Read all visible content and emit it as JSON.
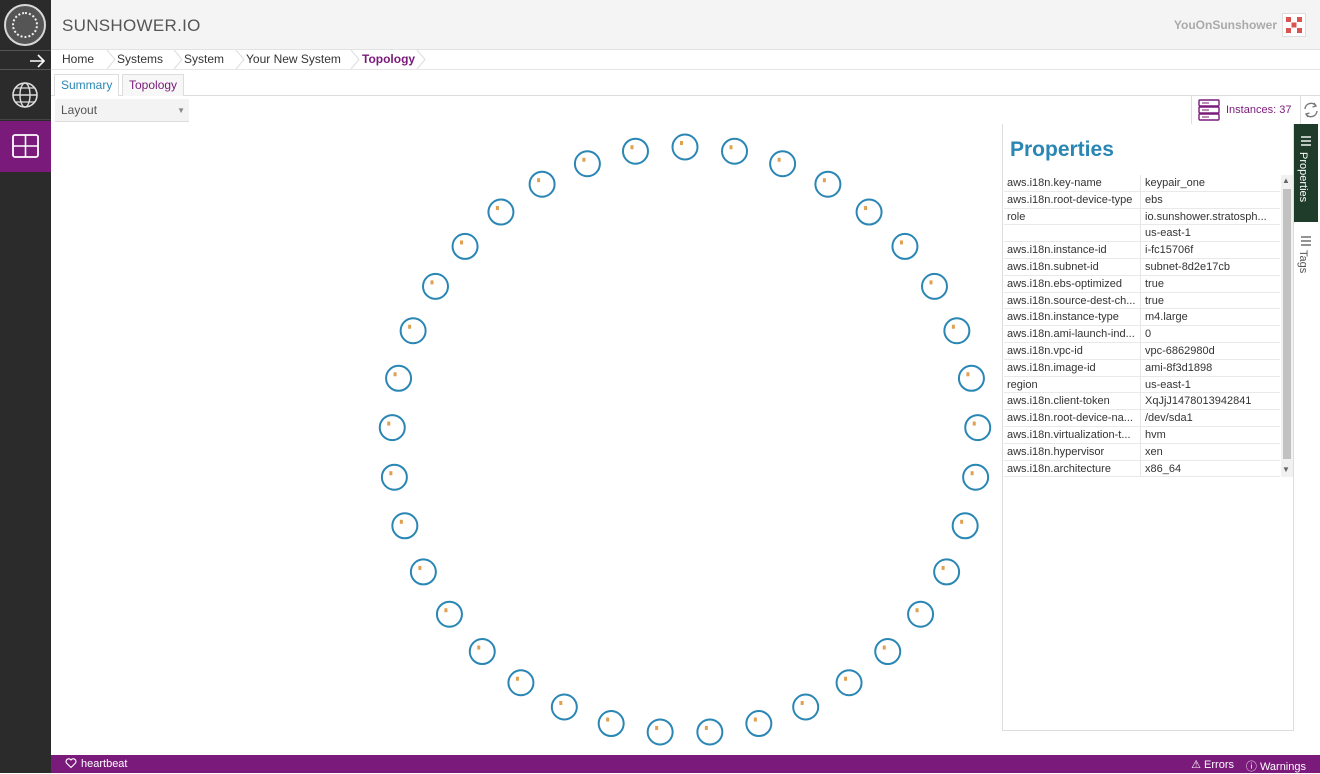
{
  "app": {
    "brand": "SUNSHOWER.IO",
    "user": "YouOnSunshower"
  },
  "breadcrumb": [
    "Home",
    "Systems",
    "System",
    "Your New System",
    "Topology"
  ],
  "tabs": {
    "summary": "Summary",
    "topology": "Topology"
  },
  "toolbar": {
    "layout_label": "Layout",
    "instances_label": "Instances: 37"
  },
  "topology": {
    "node_count": 37,
    "layout": "circle",
    "node_color": "#2a86b4"
  },
  "properties": {
    "title": "Properties",
    "rows": [
      {
        "key": "aws.i18n.key-name",
        "value": "keypair_one"
      },
      {
        "key": "aws.i18n.root-device-type",
        "value": "ebs"
      },
      {
        "key": "role",
        "value": "io.sunshower.stratosph..."
      },
      {
        "key": "",
        "value": "us-east-1"
      },
      {
        "key": "aws.i18n.instance-id",
        "value": "i-fc15706f"
      },
      {
        "key": "aws.i18n.subnet-id",
        "value": "subnet-8d2e17cb"
      },
      {
        "key": "aws.i18n.ebs-optimized",
        "value": "true"
      },
      {
        "key": "aws.i18n.source-dest-ch...",
        "value": "true"
      },
      {
        "key": "aws.i18n.instance-type",
        "value": "m4.large"
      },
      {
        "key": "aws.i18n.ami-launch-ind...",
        "value": "0"
      },
      {
        "key": "aws.i18n.vpc-id",
        "value": "vpc-6862980d"
      },
      {
        "key": "aws.i18n.image-id",
        "value": "ami-8f3d1898"
      },
      {
        "key": "region",
        "value": "us-east-1"
      },
      {
        "key": "aws.i18n.client-token",
        "value": "XqJjJ1478013942841"
      },
      {
        "key": "aws.i18n.root-device-na...",
        "value": "/dev/sda1"
      },
      {
        "key": "aws.i18n.virtualization-t...",
        "value": "hvm"
      },
      {
        "key": "aws.i18n.hypervisor",
        "value": "xen"
      },
      {
        "key": "aws.i18n.architecture",
        "value": "x86_64"
      }
    ]
  },
  "side_tabs": {
    "properties": "Properties",
    "tags": "Tags"
  },
  "footer": {
    "heartbeat": "heartbeat",
    "errors": "Errors",
    "warnings": "Warnings"
  },
  "colors": {
    "brand_purple": "#7a1a7a",
    "accent_blue": "#2a86b4",
    "nav_dark": "#2b2b2b"
  }
}
